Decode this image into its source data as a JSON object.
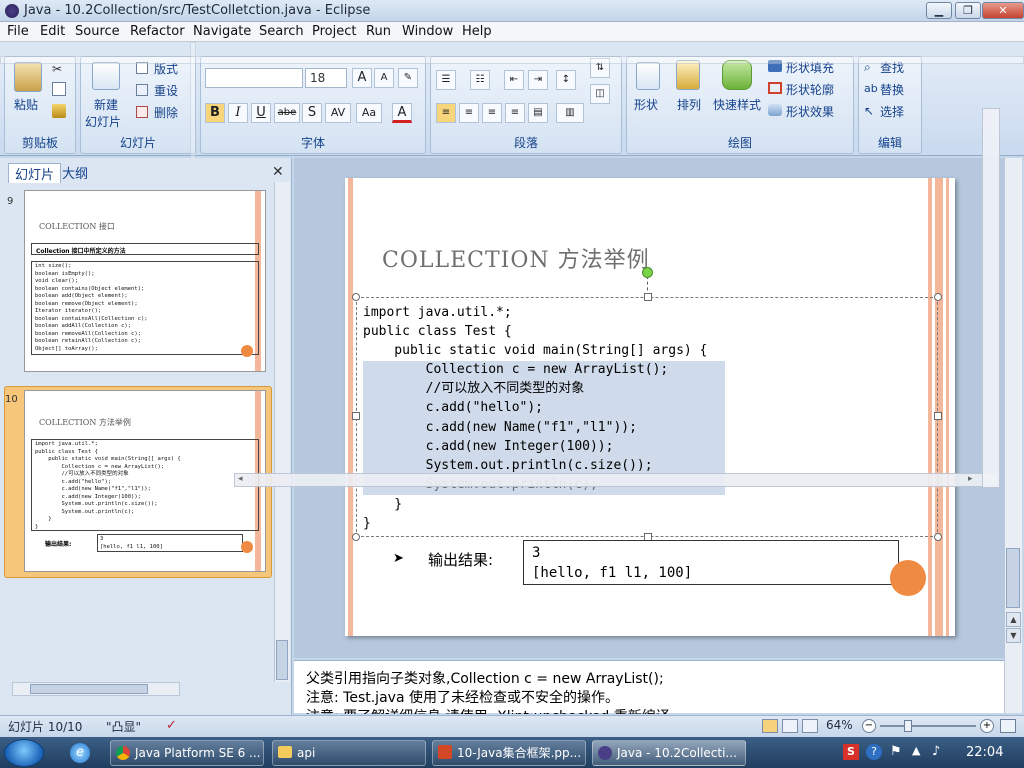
{
  "window": {
    "title": "Java - 10.2Collection/src/TestColletction.java - Eclipse",
    "minimize": "▁",
    "maximize": "❐",
    "close": "✕"
  },
  "menubar": [
    "File",
    "Edit",
    "Source",
    "Refactor",
    "Navigate",
    "Search",
    "Project",
    "Run",
    "Window",
    "Help"
  ],
  "ribbon": {
    "clipboard": {
      "label": "剪贴板",
      "paste": "粘贴"
    },
    "slides": {
      "label": "幻灯片",
      "new_slide": "新建",
      "new_slide2": "幻灯片",
      "layout": "版式",
      "reset": "重设",
      "delete": "删除"
    },
    "font": {
      "label": "字体",
      "size": "18",
      "bold": "B",
      "italic": "I",
      "underline": "U",
      "strike": "abe",
      "shadow": "S",
      "spacing": "AV",
      "case": "Aa",
      "color": "A"
    },
    "paragraph": {
      "label": "段落"
    },
    "drawing": {
      "label": "绘图",
      "shapes": "形状",
      "arrange": "排列",
      "quick_styles": "快速样式",
      "fill": "形状填充",
      "outline": "形状轮廓",
      "effects": "形状效果"
    },
    "editing": {
      "label": "编辑",
      "find": "查找",
      "replace": "替换",
      "select": "选择"
    }
  },
  "left_panel": {
    "tab_slides": "幻灯片",
    "tab_outline": "大纲",
    "close": "✕",
    "slide9": {
      "number": "9",
      "title": "COLLECTION 接口",
      "bullet": "Collection 接口中所定义的方法",
      "code": "int size();\nboolean isEmpty();\nvoid clear();\nboolean contains(Object element);\nboolean add(Object element);\nboolean remove(Object element);\nIterator iterator();\nboolean containsAll(Collection c);\nboolean addAll(Collection c);\nboolean removeAll(Collection c);\nboolean retainAll(Collection c);\nObject[] toArray();"
    },
    "slide10": {
      "number": "10",
      "title": "COLLECTION 方法举例",
      "code": "import java.util.*;\npublic class Test {\n    public static void main(String[] args) {\n        Collection c = new ArrayList();\n        //可以放入不同类型的对象\n        c.add(\"hello\");\n        c.add(new Name(\"f1\",\"l1\"));\n        c.add(new Integer(100));\n        System.out.println(c.size());\n        System.out.println(c);\n    }\n}",
      "output_label": "输出结果:",
      "output": "3\n[hello, f1 l1, 100]"
    }
  },
  "slide": {
    "title": "COLLECTION 方法举例",
    "code_lines": [
      "import java.util.*;",
      "public class Test {",
      "    public static void main(String[] args) {",
      "        Collection c = new ArrayList();",
      "        //可以放入不同类型的对象",
      "        c.add(\"hello\");",
      "        c.add(new Name(\"f1\",\"l1\"));",
      "        c.add(new Integer(100));",
      "        System.out.println(c.size());",
      "        System.out.println(c);",
      "    }",
      "}"
    ],
    "output_label": "输出结果:",
    "output_line1": "3",
    "output_line2": "[hello, f1 l1, 100]"
  },
  "notes": {
    "line1": "父类引用指向子类对象,Collection c = new ArrayList();",
    "line2": "注意: Test.java 使用了未经检查或不安全的操作。",
    "line3": "注意: 要了解详细信息,请使用 -Xlint:unchecked 重新编译"
  },
  "status": {
    "slide_pos": "幻灯片 10/10",
    "theme": "\"凸显\"",
    "zoom": "64%"
  },
  "taskbar": {
    "tasks": [
      "Java Platform SE 6 ...",
      "api",
      "10-Java集合框架.pp...",
      "Java - 10.2Collecti..."
    ],
    "clock": "22:04"
  }
}
